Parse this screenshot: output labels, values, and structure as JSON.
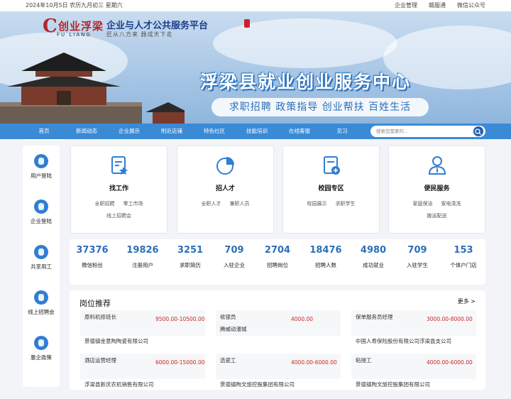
{
  "topbar": {
    "date": "2024年10月5日  农历九月初三  星期六",
    "links": [
      "企业管理",
      "赣服通",
      "微信公众号"
    ]
  },
  "banner": {
    "logo_mark": "C",
    "logo_cn": "创业浮梁",
    "logo_en": "FU  LIANG",
    "platform_title": "企业与人才公共服务平台",
    "slogan": "匠从八方来   器成天下走",
    "main_title": "浮梁县就业创业服务中心",
    "tagline": "求职招聘  政策指导  创业帮扶  百姓生活"
  },
  "nav": {
    "items": [
      "首页",
      "新闻动态",
      "企业展示",
      "附近店铺",
      "特色社区",
      "技能培训",
      "在线客服",
      "见习"
    ],
    "search_placeholder": "搜索您需要的..."
  },
  "sidebar": {
    "items": [
      "用户登陆",
      "企业登陆",
      "共享用工",
      "线上招聘会",
      "惠企政策"
    ]
  },
  "cards": [
    {
      "title": "找工作",
      "links": [
        "全职招聘",
        "零工市场",
        "线上招聘会"
      ],
      "icon": "document-star-icon"
    },
    {
      "title": "招人才",
      "links": [
        "全职人才",
        "兼职人员"
      ],
      "icon": "pie-chart-icon"
    },
    {
      "title": "校园专区",
      "links": [
        "校园展示",
        "求职学生"
      ],
      "icon": "document-add-icon"
    },
    {
      "title": "便民服务",
      "links": [
        "家庭保洁",
        "家电清洗",
        "搬运配送"
      ],
      "icon": "person-icon"
    }
  ],
  "stats": [
    {
      "num": "37376",
      "label": "微信粉丝"
    },
    {
      "num": "19826",
      "label": "注册用户"
    },
    {
      "num": "3251",
      "label": "求职简历"
    },
    {
      "num": "709",
      "label": "入驻企业"
    },
    {
      "num": "2704",
      "label": "招聘岗位"
    },
    {
      "num": "18476",
      "label": "招聘人数"
    },
    {
      "num": "4980",
      "label": "成功就业"
    },
    {
      "num": "709",
      "label": "入驻学生"
    },
    {
      "num": "153",
      "label": "个体户门店"
    }
  ],
  "jobs": {
    "title": "岗位推荐",
    "more": "更多 >",
    "items": [
      {
        "name": "原料机修班长",
        "salary": "9500.00-10500.00",
        "company": "景德镇金意陶陶瓷有限公司"
      },
      {
        "name": "收银员",
        "salary": "4000.00",
        "company": "腾威动漫城"
      },
      {
        "name": "保单服务员经理",
        "salary": "3000.00-8000.00",
        "company": "中国人寿保险股份有限公司浮梁县支公司"
      },
      {
        "name": "酒店运营经理",
        "salary": "6000.00-15000.00",
        "company": "浮梁县新庆农机销售有限公司"
      },
      {
        "name": "选瓷工",
        "salary": "4000.00-6000.00",
        "company": "景德镇陶文旅控股集团有限公司"
      },
      {
        "name": "粘接工",
        "salary": "4000.00-6000.00",
        "company": "景德镇陶文旅控股集团有限公司"
      }
    ]
  },
  "colors": {
    "nav": "#3a8ad6",
    "accent": "#2c6fb8",
    "salary": "#c62828"
  }
}
